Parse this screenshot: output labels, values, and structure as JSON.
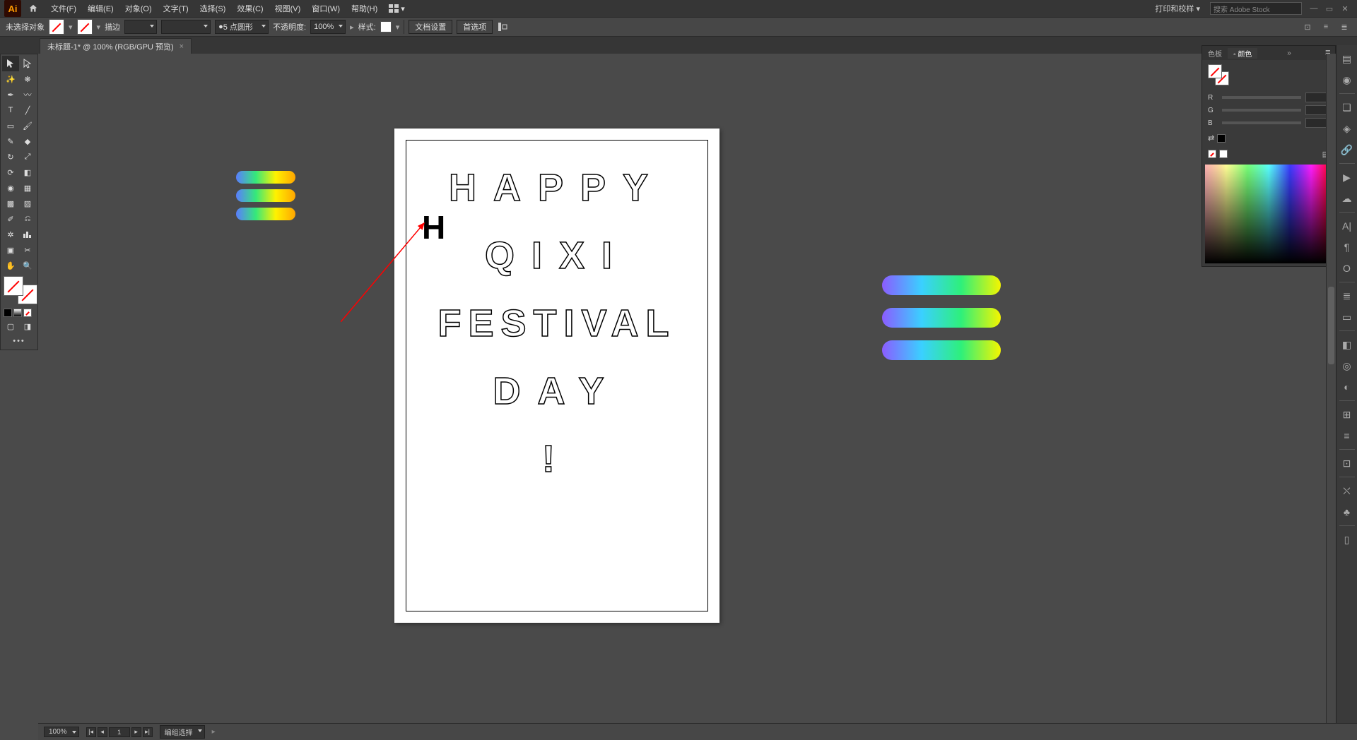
{
  "app_logo": "Ai",
  "menu": {
    "file": "文件(F)",
    "edit": "编辑(E)",
    "object": "对象(O)",
    "type": "文字(T)",
    "select": "选择(S)",
    "effect": "效果(C)",
    "view": "视图(V)",
    "window": "窗口(W)",
    "help": "帮助(H)"
  },
  "header_right": {
    "print_proof": "打印和校样",
    "search_placeholder": "搜索 Adobe Stock"
  },
  "control": {
    "no_selection": "未选择对象",
    "stroke_label": "描边",
    "stroke_weight": "",
    "stroke_profile": "5 点圆形",
    "opacity_label": "不透明度:",
    "opacity_value": "100%",
    "style_label": "样式:",
    "doc_setup": "文档设置",
    "prefs": "首选项",
    "stroke_point_value": "5"
  },
  "document_tab": {
    "name": "未标题-1* @ 100% (RGB/GPU 预览)"
  },
  "artboard_text": {
    "line1": "HAPPY",
    "line2": "QIXI",
    "line3": "FESTIVAL",
    "line4": "DAY",
    "line5": "!",
    "bold_h": "H"
  },
  "color_panel": {
    "tab_swatches": "色板",
    "tab_color": "颜色",
    "r_label": "R",
    "g_label": "G",
    "b_label": "B"
  },
  "status": {
    "zoom": "100%",
    "artboard_num": "1",
    "group_select": "编组选择"
  },
  "tooltip_close": "×",
  "dbl_arrow": "»"
}
